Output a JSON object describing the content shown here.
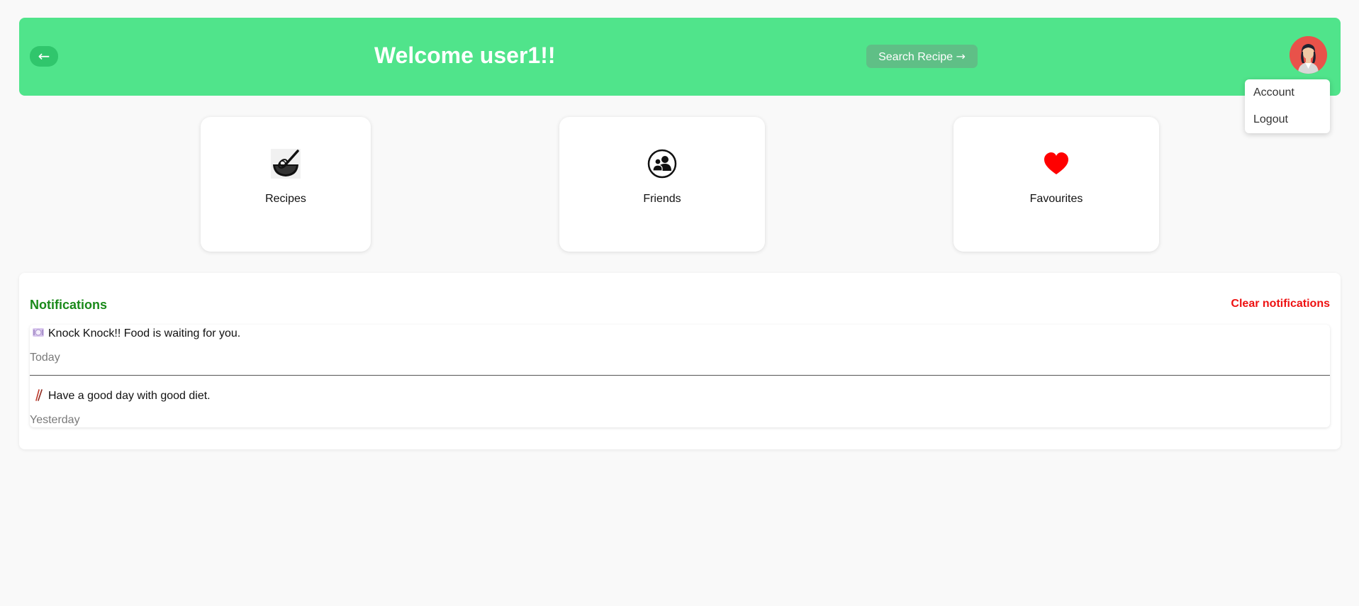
{
  "header": {
    "back_label": "←",
    "welcome": "Welcome user1!!",
    "search_label": "Search Recipe",
    "search_arrow": "→",
    "background_color": "#50e48b",
    "avatar_icon": "user-avatar-icon"
  },
  "account_menu": {
    "items": [
      {
        "label": "Account"
      },
      {
        "label": "Logout"
      }
    ]
  },
  "cards": [
    {
      "label": "Recipes",
      "icon": "whisk-bowl-icon"
    },
    {
      "label": "Friends",
      "icon": "friends-icon"
    },
    {
      "label": "Favourites",
      "icon": "heart-icon"
    }
  ],
  "notifications": {
    "title": "Notifications",
    "clear_label": "Clear notifications",
    "title_color": "#1a8a1a",
    "clear_color": "#ee1111",
    "items": [
      {
        "icon": "plate-icon",
        "message": "Knock Knock!! Food is waiting for you.",
        "when": "Today"
      },
      {
        "icon": "chopsticks-icon",
        "message": "Have a good day with good diet.",
        "when": "Yesterday"
      }
    ]
  }
}
